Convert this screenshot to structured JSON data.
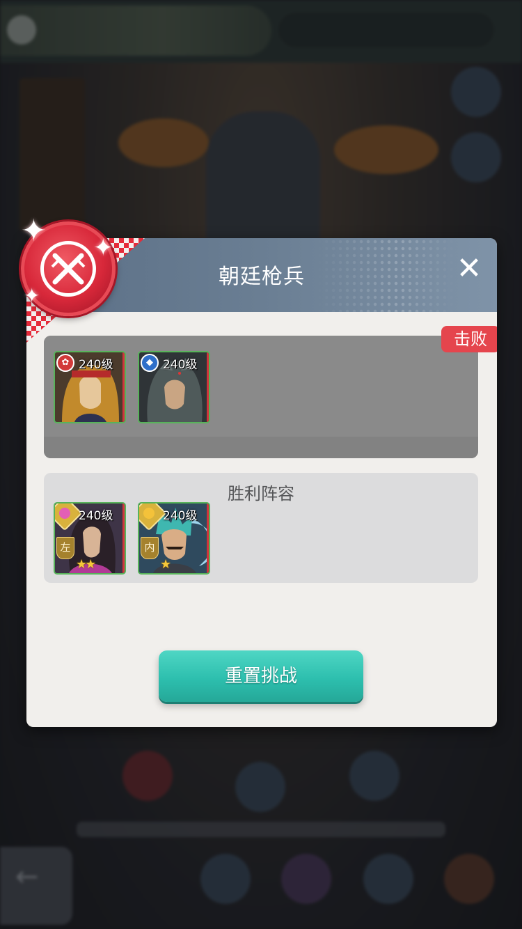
{
  "dialog": {
    "title": "朝廷枪兵",
    "close_icon": "close-icon",
    "defeat_label": "击败",
    "enemy_team": [
      {
        "level": "240级",
        "element": "fire",
        "portrait": "long-haired-warrior"
      },
      {
        "level": "240级",
        "element": "water",
        "portrait": "wolf-hood-warrior"
      }
    ],
    "victory_title": "胜利阵容",
    "victory_team": [
      {
        "level": "240级",
        "class_gem": "pink",
        "position": "左",
        "stars": "★★"
      },
      {
        "level": "240级",
        "class_gem": "gold",
        "position": "内",
        "stars": "★"
      }
    ],
    "reset_button": "重置挑战"
  },
  "colors": {
    "header": "#6a7e93",
    "defeat": "#e5454d",
    "button": "#2dbfae",
    "emblem": "#d8283a"
  }
}
